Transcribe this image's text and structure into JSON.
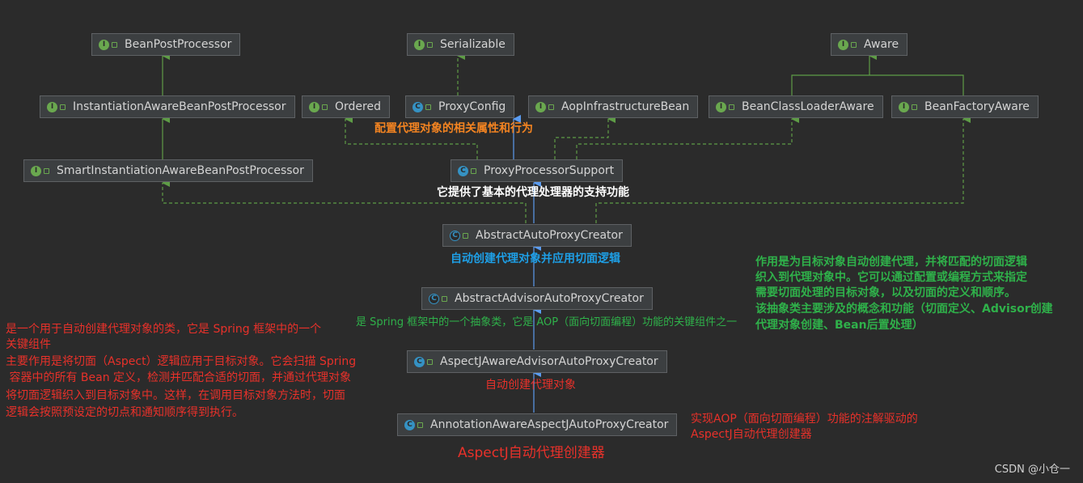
{
  "nodes": {
    "bean_post_processor": "BeanPostProcessor",
    "serializable": "Serializable",
    "aware": "Aware",
    "instantiation_aware": "InstantiationAwareBeanPostProcessor",
    "ordered": "Ordered",
    "proxy_config": "ProxyConfig",
    "aop_infrastructure_bean": "AopInfrastructureBean",
    "bean_class_loader_aware": "BeanClassLoaderAware",
    "bean_factory_aware": "BeanFactoryAware",
    "smart_instantiation_aware": "SmartInstantiationAwareBeanPostProcessor",
    "proxy_processor_support": "ProxyProcessorSupport",
    "abstract_auto_proxy_creator": "AbstractAutoProxyCreator",
    "abstract_advisor_auto_proxy_creator": "AbstractAdvisorAutoProxyCreator",
    "aspectj_aware_advisor_auto_proxy_creator": "AspectJAwareAdvisorAutoProxyCreator",
    "annotation_aware_aspectj_auto_proxy_creator": "AnnotationAwareAspectJAutoProxyCreator"
  },
  "annotations": {
    "proxy_config_note": "配置代理对象的相关属性和行为",
    "proxy_processor_support_note": "它提供了基本的代理处理器的支持功能",
    "abstract_auto_proxy_creator_note": "自动创建代理对象并应用切面逻辑",
    "abstract_advisor_note": "是 Spring 框架中的一个抽象类，它是 AOP（面向切面编程）功能的关键组件之一",
    "aspectj_aware_note": "自动创建代理对象",
    "annotation_aware_note_1": "实现AOP（面向切面编程）功能的注解驱动的",
    "annotation_aware_note_2": "AspectJ自动代理创建器",
    "bottom_title": "AspectJ自动代理创建器",
    "left_lines": [
      "是一个用于自动创建代理对象的类，它是 Spring 框架中的一个",
      "关键组件",
      "主要作用是将切面（Aspect）逻辑应用于目标对象。它会扫描 Spring",
      " 容器中的所有 Bean 定义，检测并匹配合适的切面，并通过代理对象",
      "将切面逻辑织入到目标对象中。这样，在调用目标对象方法时，切面",
      "逻辑会按照预设定的切点和通知顺序得到执行。"
    ],
    "right_lines": [
      "作用是为目标对象自动创建代理，并将匹配的切面逻辑",
      "织入到代理对象中。它可以通过配置或编程方式来指定",
      "需要切面处理的目标对象，以及切面的定义和顺序。",
      "该抽象类主要涉及的概念和功能（切面定义、Advisor创建",
      "代理对象创建、Bean后置处理）"
    ]
  },
  "watermark": "CSDN @小仓一",
  "colors": {
    "background": "#2b2b2b",
    "node_fill": "#3c3f41",
    "extends_line": "#5b9cf0",
    "implements_line": "#5e9c46",
    "red": "#e8312a",
    "green": "#2fb14a",
    "orange": "#f48421",
    "blue": "#1e9fe6"
  }
}
